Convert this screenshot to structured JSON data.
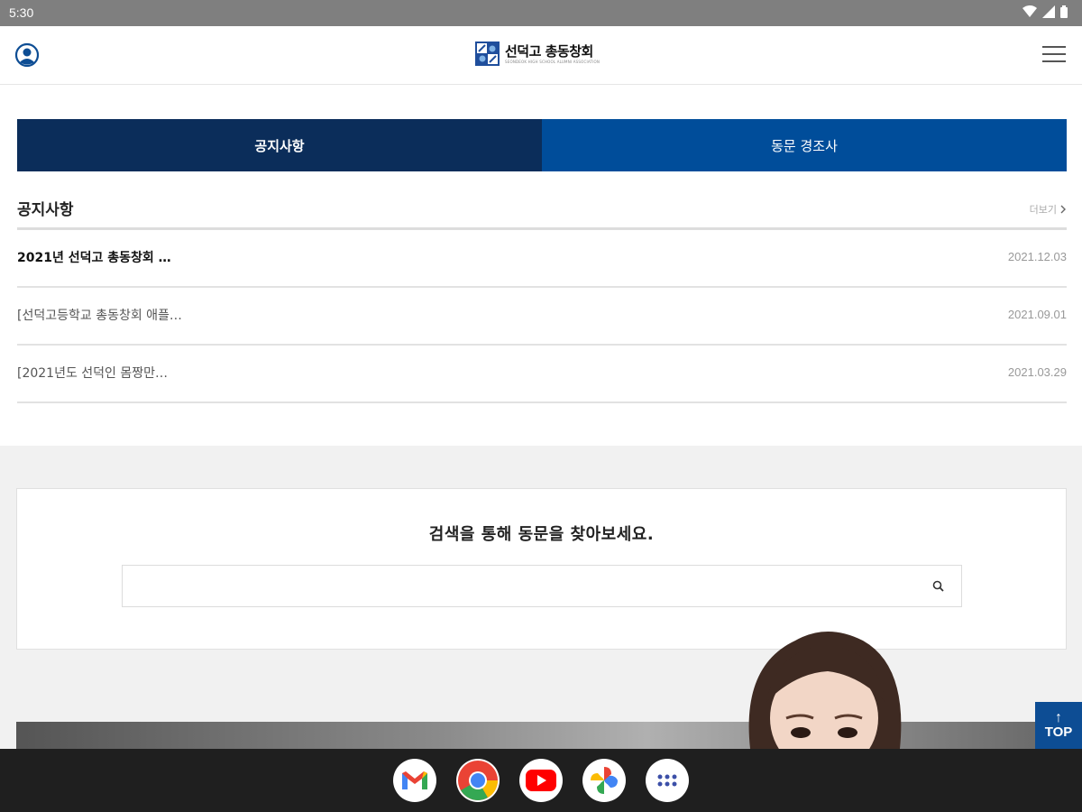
{
  "status_bar": {
    "time": "5:30"
  },
  "header": {
    "logo_title": "선덕고 총동창회",
    "logo_subtitle": "SEONDEOK HIGH SCHOOL ALUMNI ASSOCIATION"
  },
  "tabs": [
    {
      "label": "공지사항",
      "active": true
    },
    {
      "label": "동문 경조사",
      "active": false
    }
  ],
  "notice": {
    "title": "공지사항",
    "more_label": "더보기",
    "items": [
      {
        "title": "2021년 선덕고 총동창회 …",
        "date": "2021.12.03"
      },
      {
        "title": "[선덕고등학교 총동창회 애플…",
        "date": "2021.09.01"
      },
      {
        "title": "[2021년도 선덕인 몸짱만…",
        "date": "2021.03.29"
      }
    ]
  },
  "search": {
    "heading": "검색을 통해 동문을 찾아보세요.",
    "value": "",
    "placeholder": ""
  },
  "top_button": {
    "label": "TOP"
  },
  "colors": {
    "tab_active": "#0b2d5a",
    "tab_inactive": "#004d9a",
    "top_button": "#0d4d94"
  },
  "dock": {
    "apps": [
      "gmail-icon",
      "chrome-icon",
      "youtube-icon",
      "photos-icon",
      "app-drawer-icon"
    ]
  }
}
